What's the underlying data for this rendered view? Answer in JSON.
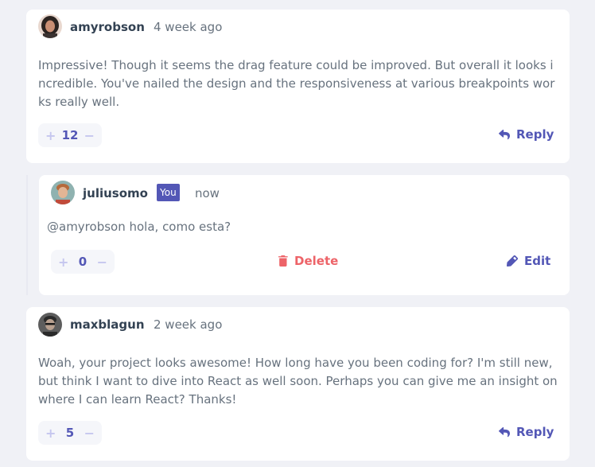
{
  "colors": {
    "background": "#f0f1f6",
    "accent": "#5357b6",
    "danger": "#ed6368",
    "text": "#67727e",
    "username": "#334253"
  },
  "comments": [
    {
      "username": "amyrobson",
      "time": "4 week ago",
      "content": "Impressive! Though it seems the drag feature could be improved. But overall it looks incredible. You've nailed the design and the responsiveness at various breakpoints works really well.",
      "score": "12",
      "reply_label": "Reply",
      "avatar_icon": "avatar-amyrobson"
    },
    {
      "username": "juliusomo",
      "you_badge": "You",
      "time": "now",
      "content": "@amyrobson hola, como esta?",
      "score": "0",
      "delete_label": "Delete",
      "edit_label": "Edit",
      "avatar_icon": "avatar-juliusomo"
    },
    {
      "username": "maxblagun",
      "time": "2 week ago",
      "content": "Woah, your project looks awesome! How long have you been coding for? I'm still new, but think I want to dive into React as well soon. Perhaps you can give me an insight on where I can learn React? Thanks!",
      "score": "5",
      "reply_label": "Reply",
      "avatar_icon": "avatar-maxblagun"
    }
  ],
  "vote": {
    "plus": "+",
    "minus": "−"
  }
}
